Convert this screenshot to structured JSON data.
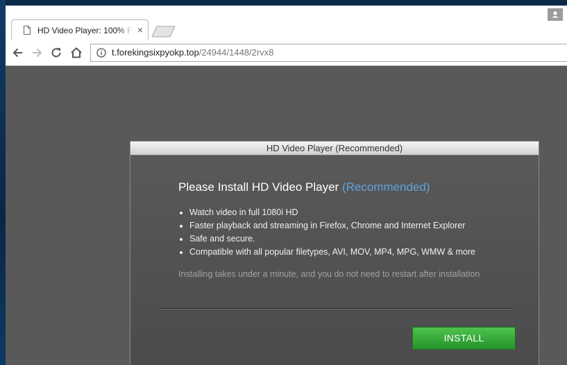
{
  "browser": {
    "tab": {
      "title": "HD Video Player: 100% F",
      "close_glyph": "×",
      "icon": "document-icon"
    },
    "toolbar": {
      "back_icon": "back-arrow-icon",
      "forward_icon": "forward-arrow-icon",
      "reload_icon": "reload-icon",
      "home_icon": "home-icon"
    },
    "address_bar": {
      "host": "t.forekingsixpyokp.top",
      "path": "/24944/1448/2rvx8",
      "icon": "info-icon"
    }
  },
  "dialog": {
    "title": "HD Video Player (Recommended)",
    "heading": "Please Install HD Video Player",
    "heading_highlight": "(Recommended)",
    "features": [
      "Watch video in full 1080i HD",
      "Faster playback and streaming in Firefox, Chrome and Internet Explorer",
      "Safe and secure.",
      "Compatible with all popular filetypes, AVI, MOV, MP4, MPG, WMW & more"
    ],
    "note": "Installing takes under a minute, and you do not need to restart after installation",
    "install_label": "INSTALL"
  },
  "colors": {
    "highlight": "#5ea2dd",
    "install_button": "#3aab3f",
    "page_background": "#595959"
  }
}
